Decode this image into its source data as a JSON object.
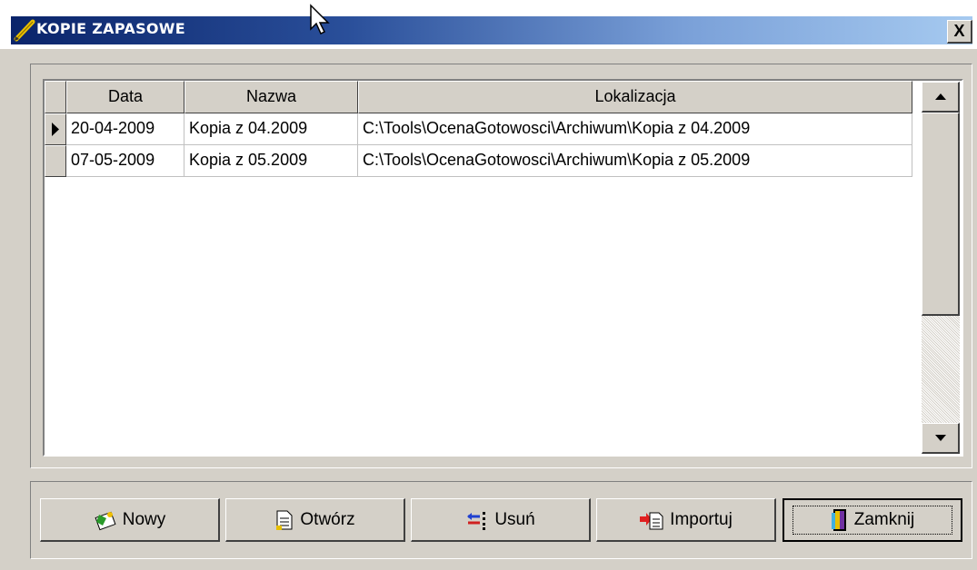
{
  "window": {
    "title": "KOPIE ZAPASOWE",
    "close_label": "X",
    "icons": {
      "title": "pencil-icon",
      "close": "close-icon"
    }
  },
  "grid": {
    "columns": [
      "Data",
      "Nazwa",
      "Lokalizacja"
    ],
    "rows": [
      {
        "data": "20-04-2009",
        "nazwa": "Kopia z 04.2009",
        "lokalizacja": "C:\\Tools\\OcenaGotowosci\\Archiwum\\Kopia z 04.2009",
        "selected": true
      },
      {
        "data": "07-05-2009",
        "nazwa": "Kopia z 05.2009",
        "lokalizacja": "C:\\Tools\\OcenaGotowosci\\Archiwum\\Kopia z 05.2009",
        "selected": false
      }
    ]
  },
  "buttons": {
    "nowy": "Nowy",
    "otworz": "Otwórz",
    "usun": "Usuń",
    "importuj": "Importuj",
    "zamknij": "Zamknij"
  },
  "colors": {
    "titlebar_start": "#0a246a",
    "titlebar_end": "#a6caf0",
    "face": "#d4d0c8"
  }
}
